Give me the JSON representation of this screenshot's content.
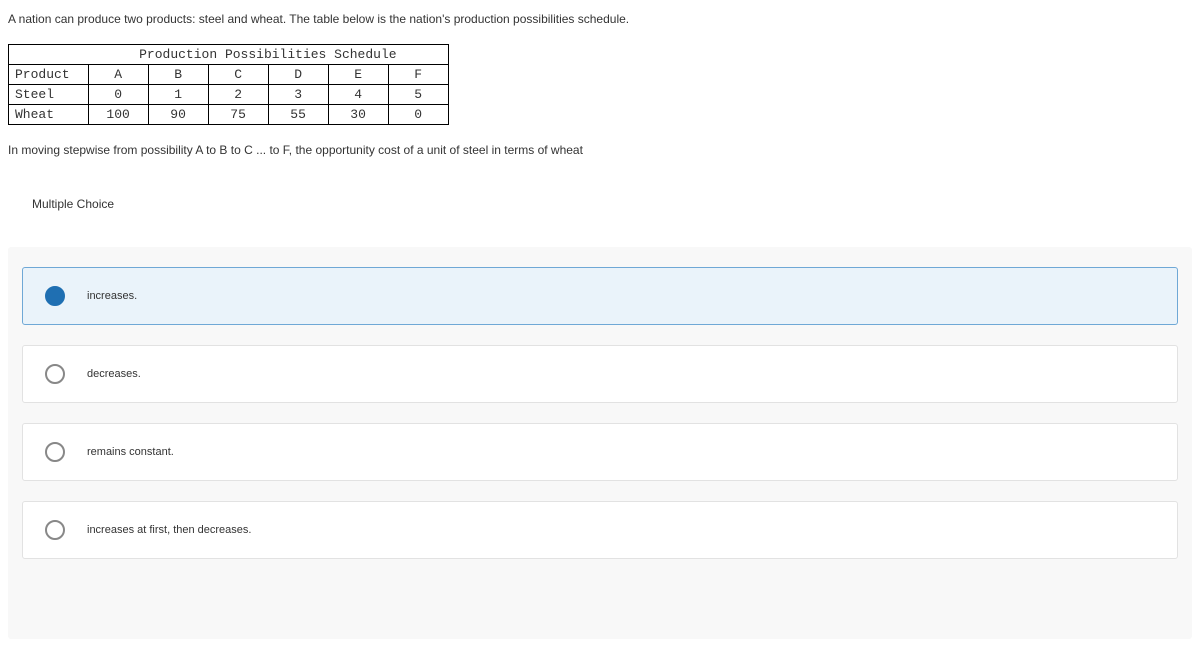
{
  "question": {
    "intro": "A nation can produce two products: steel and wheat. The table below is the nation's production possibilities schedule.",
    "followup": "In moving stepwise from possibility A to B to C ... to F, the opportunity cost of a unit of steel in terms of wheat"
  },
  "table": {
    "title": "Production Possibilities Schedule",
    "header_row_label": "Product",
    "columns": [
      "A",
      "B",
      "C",
      "D",
      "E",
      "F"
    ],
    "rows": [
      {
        "label": "Steel",
        "values": [
          "0",
          "1",
          "2",
          "3",
          "4",
          "5"
        ]
      },
      {
        "label": "Wheat",
        "values": [
          "100",
          "90",
          "75",
          "55",
          "30",
          "0"
        ]
      }
    ]
  },
  "mc": {
    "heading": "Multiple Choice",
    "choices": [
      {
        "label": "increases.",
        "selected": true
      },
      {
        "label": "decreases.",
        "selected": false
      },
      {
        "label": "remains constant.",
        "selected": false
      },
      {
        "label": "increases at first, then decreases.",
        "selected": false
      }
    ]
  }
}
